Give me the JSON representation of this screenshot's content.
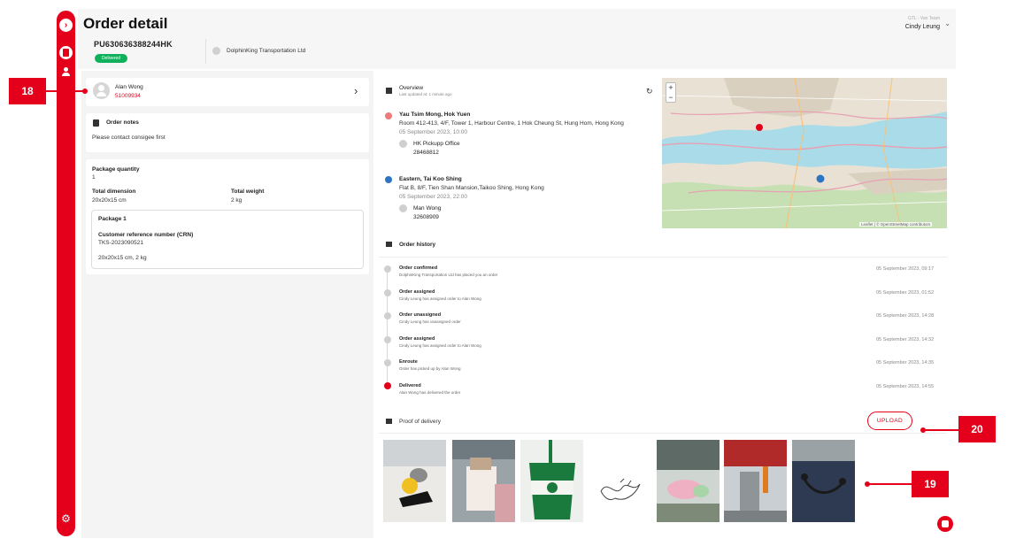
{
  "header": {
    "title": "Order detail",
    "user_role": "GTL - Van Team",
    "user_name": "Cindy Leung"
  },
  "order": {
    "number": "PU630636388244HK",
    "status": "Delivered",
    "company": "DolphinKing Transportation Ltd"
  },
  "courier": {
    "name": "Alan Wong",
    "phone": "51009934"
  },
  "notes": {
    "title": "Order notes",
    "text": "Please contact consigee first"
  },
  "package": {
    "quantity_label": "Package quantity",
    "quantity": "1",
    "dimension_label": "Total dimension",
    "dimension": "20x20x15 cm",
    "weight_label": "Total weight",
    "weight": "2 kg",
    "item_title": "Package 1",
    "crn_label": "Customer reference number (CRN)",
    "crn": "TKS-2023090521",
    "item_summary": "20x20x15 cm, 2 kg"
  },
  "overview": {
    "title": "Overview",
    "updated": "Last updated at: 1 minute ago",
    "pickup": {
      "district": "Yau Tsim Mong, Hok Yuen",
      "address": "Room 412-413, 4/F, Tower 1, Harbour Centre, 1 Hok Cheung St, Hung Hom, Hong Kong",
      "time": "05 September 2023, 10:00",
      "contact_name": "HK Pickupp Office",
      "contact_phone": "28468812"
    },
    "dropoff": {
      "district": "Eastern, Tai Koo Shing",
      "address": "Flat B, 8/F, Tien Shan Mansion,Taikoo Shing, Hong Kong",
      "time": "05 September 2023, 22:00",
      "contact_name": "Man Wong",
      "contact_phone": "32608909"
    }
  },
  "map": {
    "attribution": "Leaflet | © OpenStreetMap contributors",
    "zoom_in": "+",
    "zoom_out": "−"
  },
  "history": {
    "title": "Order history",
    "events": [
      {
        "title": "Order confirmed",
        "desc": "DolphinKing Transportation Ltd has placed you an order",
        "time": "05 September 2023, 09:17"
      },
      {
        "title": "Order assigned",
        "desc": "Cindy Leung has assigned order to Alan Wong",
        "time": "05 September 2023, 01:52"
      },
      {
        "title": "Order unassigned",
        "desc": "Cindy Leung has unassigned order",
        "time": "05 September 2023, 14:28"
      },
      {
        "title": "Order assigned",
        "desc": "Cindy Leung has assigned order to Alan Wong",
        "time": "05 September 2023, 14:32"
      },
      {
        "title": "Enroute",
        "desc": "Order has picked up by Alan Wong",
        "time": "05 September 2023, 14:35"
      },
      {
        "title": "Delivered",
        "desc": "Alan Wong has delivered the order",
        "time": "05 September 2023, 14:55"
      }
    ]
  },
  "pod": {
    "title": "Proof of delivery",
    "upload_label": "UPLOAD"
  },
  "callouts": {
    "a": "18",
    "b": "20",
    "c": "19"
  },
  "colors": {
    "brand": "#e4001b",
    "status_green": "#12b05c",
    "dropoff_pin": "#2d74c4"
  }
}
